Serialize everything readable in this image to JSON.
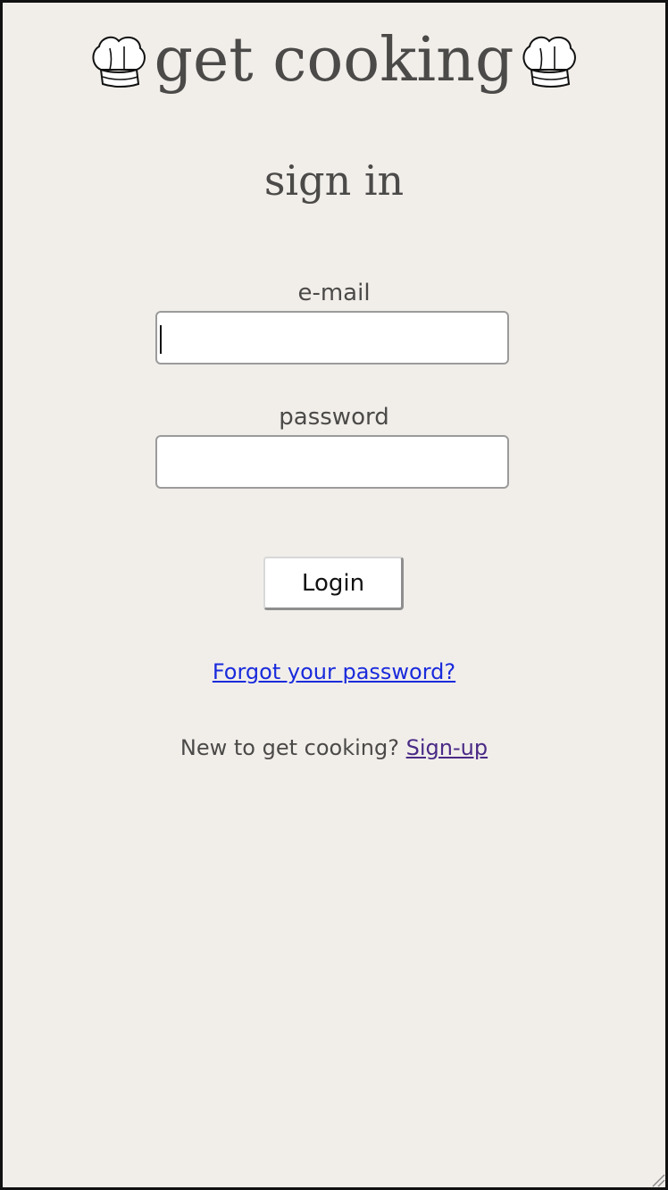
{
  "header": {
    "title": "get cooking",
    "left_icon": "chef-hat-icon",
    "right_icon": "chef-hat-icon"
  },
  "page": {
    "heading": "sign in"
  },
  "form": {
    "email_label": "e-mail",
    "email_value": "",
    "password_label": "password",
    "password_value": "",
    "login_label": "Login"
  },
  "links": {
    "forgot_password": "Forgot your password?",
    "signup_prompt": "New to get cooking?",
    "signup_label": "Sign-up"
  },
  "colors": {
    "background": "#f1eeea",
    "text": "#4b4a48",
    "link": "#1a2bdc",
    "visited_link": "#4a2a86"
  }
}
